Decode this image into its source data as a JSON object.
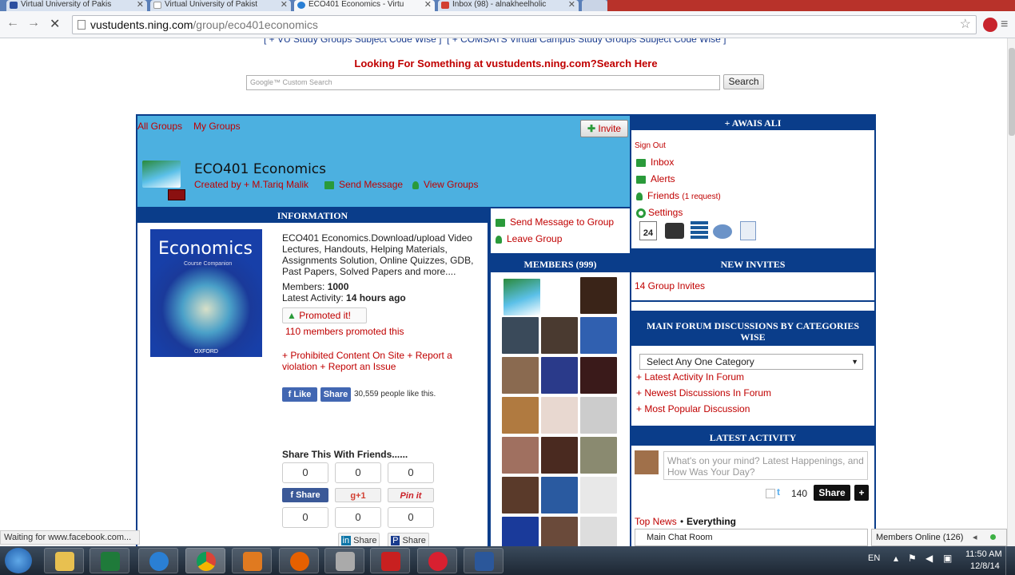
{
  "browser": {
    "tabs": [
      {
        "label": "Virtual University of Pakis",
        "active": false
      },
      {
        "label": "Virtual University of Pakist",
        "active": false
      },
      {
        "label": "ECO401 Economics - Virtu",
        "active": true
      },
      {
        "label": "Inbox (98) - alnakheelholic",
        "active": false
      }
    ],
    "url_host": "vustudents.ning.com",
    "url_path": "/group/eco401economics",
    "status": "Waiting for www.facebook.com..."
  },
  "top": {
    "top_links": [
      "VU Study Groups Subject Code Wise",
      "COMSATS Virtual Campus Study Groups Subject Code Wise"
    ],
    "search_heading": "Looking For Something at vustudents.ning.com?Search Here",
    "search_placeholder": "Custom Search",
    "search_google": "Google",
    "search_button": "Search"
  },
  "group": {
    "nav_all": "All Groups",
    "nav_my": "My Groups",
    "invite": "Invite",
    "title": "ECO401 Economics",
    "created_by": "Created by + M.Tariq Malik",
    "send_message": "Send Message",
    "view_groups": "View Groups"
  },
  "information": {
    "heading": "INFORMATION",
    "book_title": "Economics",
    "book_subtitle": "Course Companion",
    "book_publisher": "OXFORD",
    "description": "ECO401 Economics.Download/upload Video Lectures, Handouts, Helping Materials, Assignments Solution, Online Quizzes, GDB, Past Papers, Solved Papers and more....",
    "members_label": "Members:",
    "members_value": "1000",
    "activity_label": "Latest Activity:",
    "activity_value": "14 hours ago",
    "promoted": "Promoted it!",
    "promoted_count": "110 members promoted this",
    "report_links": "+ Prohibited Content On Site + Report a violation + Report an Issue",
    "fb_like": "Like",
    "fb_share": "Share",
    "fb_count": "30,559 people like this.",
    "share_heading": "Share This With Friends......",
    "counts": [
      "0",
      "0",
      "0",
      "0",
      "0",
      "0"
    ],
    "share_fb": "Share",
    "share_gplus": "g+1",
    "share_pin": "Pin it",
    "share_in": "Share",
    "share_p": "Share"
  },
  "actions": {
    "send_to_group": "Send Message to Group",
    "leave_group": "Leave Group"
  },
  "members": {
    "heading": "MEMBERS (999)"
  },
  "user": {
    "heading": "+ AWAIS ALI",
    "sign_out": "Sign Out",
    "inbox": "Inbox",
    "alerts": "Alerts",
    "friends": "Friends",
    "friends_note": "(1 request)",
    "settings": "Settings",
    "calendar_day": "24"
  },
  "invites": {
    "heading": "NEW INVITES",
    "link": "14 Group Invites"
  },
  "forum": {
    "heading": "MAIN FORUM DISCUSSIONS BY CATEGORIES WISE",
    "select": "Select Any One Category",
    "links": [
      "Latest Activity In Forum",
      "Newest Discussions In Forum",
      "Most Popular Discussion"
    ]
  },
  "activity": {
    "heading": "LATEST ACTIVITY",
    "placeholder": "What's on your mind? Latest Happenings, and How Was Your Day?",
    "char_count": "140",
    "share": "Share",
    "plus": "+",
    "top_news": "Top News",
    "dot": "•",
    "everything": "Everything"
  },
  "chat": {
    "room": "Main Chat Room",
    "online": "Members Online (126)"
  },
  "taskbar": {
    "lang": "EN",
    "time": "11:50 AM",
    "date": "12/8/14"
  }
}
